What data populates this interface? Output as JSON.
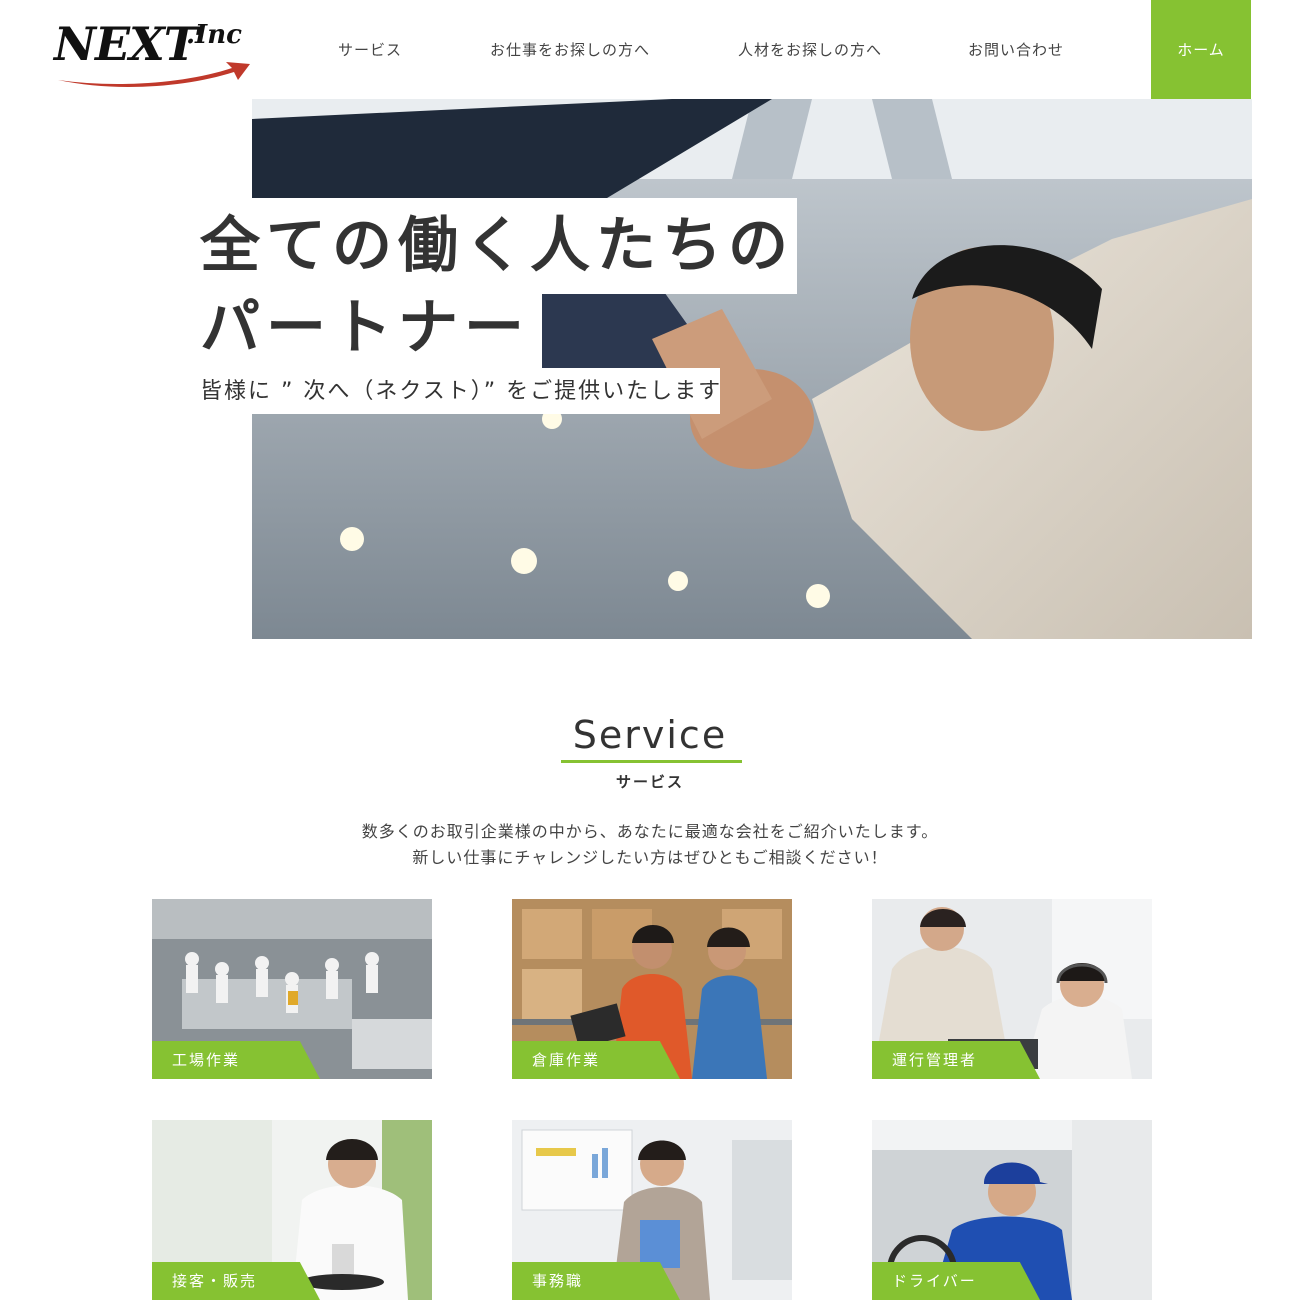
{
  "header": {
    "logo_text": "NEXT",
    "logo_suffix": ".Inc",
    "nav": [
      {
        "label": "サービス"
      },
      {
        "label": "お仕事をお探しの方へ"
      },
      {
        "label": "人材をお探しの方へ"
      },
      {
        "label": "お問い合わせ"
      },
      {
        "label": "ホーム"
      }
    ]
  },
  "hero": {
    "title_line1": "全ての働く人たちの",
    "title_line2": "パートナー",
    "subtitle": "皆様に ” 次へ（ネクスト）” をご提供いたします"
  },
  "service": {
    "title": "Service",
    "subtitle": "サービス",
    "desc_line1": "数多くのお取引企業様の中から、あなたに最適な会社をご紹介いたします。",
    "desc_line2": "新しい仕事にチャレンジしたい方はぜひともご相談ください！",
    "cards": [
      {
        "label": "工場作業"
      },
      {
        "label": "倉庫作業"
      },
      {
        "label": "運行管理者"
      },
      {
        "label": "接客・販売"
      },
      {
        "label": "事務職"
      },
      {
        "label": "ドライバー"
      }
    ]
  },
  "colors": {
    "accent": "#86c232",
    "text": "#333333",
    "logo_swoosh": "#c0392b"
  }
}
